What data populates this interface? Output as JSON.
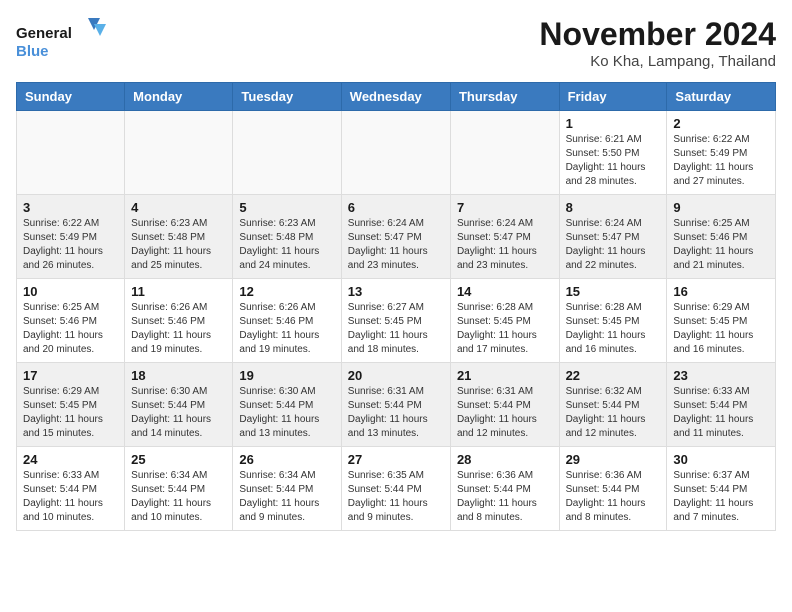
{
  "header": {
    "logo_line1": "General",
    "logo_line2": "Blue",
    "month": "November 2024",
    "location": "Ko Kha, Lampang, Thailand"
  },
  "weekdays": [
    "Sunday",
    "Monday",
    "Tuesday",
    "Wednesday",
    "Thursday",
    "Friday",
    "Saturday"
  ],
  "weeks": [
    [
      {
        "day": "",
        "info": ""
      },
      {
        "day": "",
        "info": ""
      },
      {
        "day": "",
        "info": ""
      },
      {
        "day": "",
        "info": ""
      },
      {
        "day": "",
        "info": ""
      },
      {
        "day": "1",
        "info": "Sunrise: 6:21 AM\nSunset: 5:50 PM\nDaylight: 11 hours and 28 minutes."
      },
      {
        "day": "2",
        "info": "Sunrise: 6:22 AM\nSunset: 5:49 PM\nDaylight: 11 hours and 27 minutes."
      }
    ],
    [
      {
        "day": "3",
        "info": "Sunrise: 6:22 AM\nSunset: 5:49 PM\nDaylight: 11 hours and 26 minutes."
      },
      {
        "day": "4",
        "info": "Sunrise: 6:23 AM\nSunset: 5:48 PM\nDaylight: 11 hours and 25 minutes."
      },
      {
        "day": "5",
        "info": "Sunrise: 6:23 AM\nSunset: 5:48 PM\nDaylight: 11 hours and 24 minutes."
      },
      {
        "day": "6",
        "info": "Sunrise: 6:24 AM\nSunset: 5:47 PM\nDaylight: 11 hours and 23 minutes."
      },
      {
        "day": "7",
        "info": "Sunrise: 6:24 AM\nSunset: 5:47 PM\nDaylight: 11 hours and 23 minutes."
      },
      {
        "day": "8",
        "info": "Sunrise: 6:24 AM\nSunset: 5:47 PM\nDaylight: 11 hours and 22 minutes."
      },
      {
        "day": "9",
        "info": "Sunrise: 6:25 AM\nSunset: 5:46 PM\nDaylight: 11 hours and 21 minutes."
      }
    ],
    [
      {
        "day": "10",
        "info": "Sunrise: 6:25 AM\nSunset: 5:46 PM\nDaylight: 11 hours and 20 minutes."
      },
      {
        "day": "11",
        "info": "Sunrise: 6:26 AM\nSunset: 5:46 PM\nDaylight: 11 hours and 19 minutes."
      },
      {
        "day": "12",
        "info": "Sunrise: 6:26 AM\nSunset: 5:46 PM\nDaylight: 11 hours and 19 minutes."
      },
      {
        "day": "13",
        "info": "Sunrise: 6:27 AM\nSunset: 5:45 PM\nDaylight: 11 hours and 18 minutes."
      },
      {
        "day": "14",
        "info": "Sunrise: 6:28 AM\nSunset: 5:45 PM\nDaylight: 11 hours and 17 minutes."
      },
      {
        "day": "15",
        "info": "Sunrise: 6:28 AM\nSunset: 5:45 PM\nDaylight: 11 hours and 16 minutes."
      },
      {
        "day": "16",
        "info": "Sunrise: 6:29 AM\nSunset: 5:45 PM\nDaylight: 11 hours and 16 minutes."
      }
    ],
    [
      {
        "day": "17",
        "info": "Sunrise: 6:29 AM\nSunset: 5:45 PM\nDaylight: 11 hours and 15 minutes."
      },
      {
        "day": "18",
        "info": "Sunrise: 6:30 AM\nSunset: 5:44 PM\nDaylight: 11 hours and 14 minutes."
      },
      {
        "day": "19",
        "info": "Sunrise: 6:30 AM\nSunset: 5:44 PM\nDaylight: 11 hours and 13 minutes."
      },
      {
        "day": "20",
        "info": "Sunrise: 6:31 AM\nSunset: 5:44 PM\nDaylight: 11 hours and 13 minutes."
      },
      {
        "day": "21",
        "info": "Sunrise: 6:31 AM\nSunset: 5:44 PM\nDaylight: 11 hours and 12 minutes."
      },
      {
        "day": "22",
        "info": "Sunrise: 6:32 AM\nSunset: 5:44 PM\nDaylight: 11 hours and 12 minutes."
      },
      {
        "day": "23",
        "info": "Sunrise: 6:33 AM\nSunset: 5:44 PM\nDaylight: 11 hours and 11 minutes."
      }
    ],
    [
      {
        "day": "24",
        "info": "Sunrise: 6:33 AM\nSunset: 5:44 PM\nDaylight: 11 hours and 10 minutes."
      },
      {
        "day": "25",
        "info": "Sunrise: 6:34 AM\nSunset: 5:44 PM\nDaylight: 11 hours and 10 minutes."
      },
      {
        "day": "26",
        "info": "Sunrise: 6:34 AM\nSunset: 5:44 PM\nDaylight: 11 hours and 9 minutes."
      },
      {
        "day": "27",
        "info": "Sunrise: 6:35 AM\nSunset: 5:44 PM\nDaylight: 11 hours and 9 minutes."
      },
      {
        "day": "28",
        "info": "Sunrise: 6:36 AM\nSunset: 5:44 PM\nDaylight: 11 hours and 8 minutes."
      },
      {
        "day": "29",
        "info": "Sunrise: 6:36 AM\nSunset: 5:44 PM\nDaylight: 11 hours and 8 minutes."
      },
      {
        "day": "30",
        "info": "Sunrise: 6:37 AM\nSunset: 5:44 PM\nDaylight: 11 hours and 7 minutes."
      }
    ]
  ]
}
